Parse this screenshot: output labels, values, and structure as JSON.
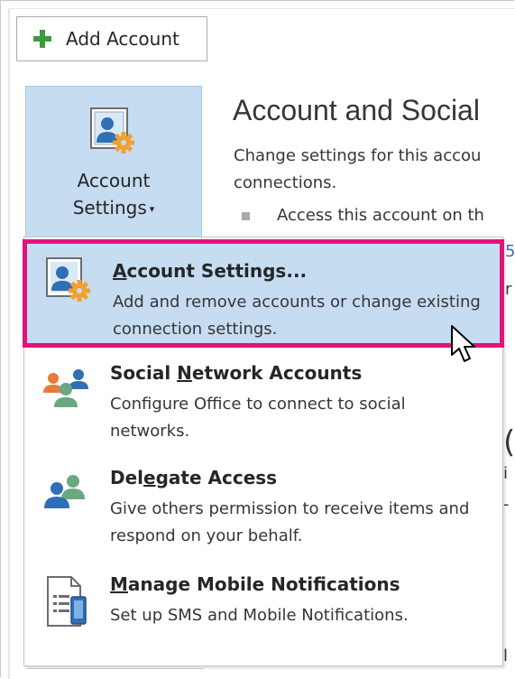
{
  "toolbar": {
    "add_account_label": "Add Account"
  },
  "account_button": {
    "line1": "Account",
    "line2": "Settings",
    "caret": "▾"
  },
  "section": {
    "title": "Account and Social",
    "desc_line1": "Change settings for this accou",
    "desc_line2": "connections.",
    "bullet": "Access this account on th"
  },
  "menu": {
    "items": [
      {
        "title_pre": "",
        "title_u": "A",
        "title_post": "ccount Settings...",
        "desc": "Add and remove accounts or change existing connection settings.",
        "icon": "account-settings-icon"
      },
      {
        "title_pre": "Social ",
        "title_u": "N",
        "title_post": "etwork Accounts",
        "desc": "Configure Office to connect to social networks.",
        "icon": "social-network-icon"
      },
      {
        "title_pre": "Del",
        "title_u": "e",
        "title_post": "gate Access",
        "desc": "Give others permission to receive items and respond on your behalf.",
        "icon": "delegate-icon"
      },
      {
        "title_pre": "",
        "title_u": "M",
        "title_post": "anage Mobile Notifications",
        "desc": "Set up SMS and Mobile Notifications.",
        "icon": "mobile-notifications-icon"
      }
    ]
  },
  "colors": {
    "selected_bg": "#c5dcf1",
    "highlight_border": "#e2137a",
    "plus": "#3c9a3c",
    "gear": "#f0a030",
    "person_blue": "#2f6fb5"
  }
}
